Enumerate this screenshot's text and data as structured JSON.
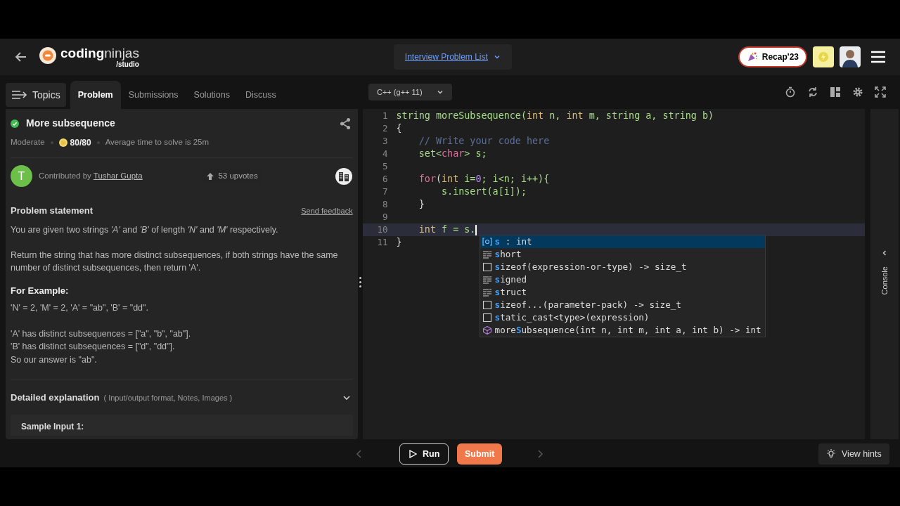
{
  "header": {
    "logo_bold": "coding",
    "logo_light": "ninjas",
    "logo_sub": "/studio",
    "nav_link": "Interview Problem List",
    "recap_label": "Recap'23"
  },
  "left_tabs": {
    "topics": "Topics",
    "tabs": [
      {
        "label": "Problem",
        "selected": true
      },
      {
        "label": "Submissions",
        "selected": false
      },
      {
        "label": "Solutions",
        "selected": false
      },
      {
        "label": "Discuss",
        "selected": false
      }
    ]
  },
  "problem": {
    "title": "More subsequence",
    "solved": true,
    "difficulty": "Moderate",
    "score": "80/80",
    "avg_time": "Average time to solve is 25m",
    "avatar_letter": "T",
    "contributed_prefix": "Contributed by",
    "contributor": "Tushar Gupta",
    "upvotes": "53 upvotes",
    "statement_heading": "Problem statement",
    "feedback": "Send feedback",
    "paragraphs": [
      "You are given two strings *'A'* and *'B'* of length *'N'* and *'M'* respectively.",
      "Return the string that has more distinct subsequences, if both strings have the same number of distinct subsequences, then return 'A'."
    ],
    "example_heading": "For Example:",
    "example_blocks": [
      [
        "'N' = 2, 'M' = 2, 'A' = \"ab\", 'B' = \"dd\"."
      ],
      [
        "'A' has distinct subsequences = [\"a\", \"b\", \"ab\"].",
        "'B' has distinct subsequences = [\"d\", \"dd\"].",
        "So our answer is \"ab\"."
      ]
    ],
    "explanation_heading": "Detailed explanation",
    "explanation_note": "( Input/output format, Notes, Images )",
    "expanded": false,
    "sample_heading": "Sample Input 1:"
  },
  "editor": {
    "language": "C++ (g++ 11)",
    "lines": [
      {
        "number": "1",
        "active": false,
        "tokens": [
          {
            "kind": "plain",
            "text": "string moreSubsequence("
          },
          {
            "kind": "type",
            "text": "int"
          },
          {
            "kind": "plain",
            "text": " n, "
          },
          {
            "kind": "type",
            "text": "int"
          },
          {
            "kind": "plain",
            "text": " m, string a, string b)"
          }
        ]
      },
      {
        "number": "2",
        "active": false,
        "tokens": [
          {
            "kind": "punct",
            "text": "{"
          }
        ]
      },
      {
        "number": "3",
        "active": false,
        "tokens": [
          {
            "kind": "comment",
            "text": "    // Write your code here"
          }
        ]
      },
      {
        "number": "4",
        "active": false,
        "tokens": [
          {
            "kind": "plain",
            "text": "    set<"
          },
          {
            "kind": "keyword",
            "text": "char"
          },
          {
            "kind": "plain",
            "text": "> s;"
          }
        ]
      },
      {
        "number": "5",
        "active": false
      },
      {
        "number": "6",
        "active": false,
        "tokens": [
          {
            "kind": "keyword",
            "text": "    for"
          },
          {
            "kind": "punct",
            "text": "("
          },
          {
            "kind": "type",
            "text": "int"
          },
          {
            "kind": "plain",
            "text": " i="
          },
          {
            "kind": "number",
            "text": "0"
          },
          {
            "kind": "plain",
            "text": "; i<n; i++){"
          }
        ]
      },
      {
        "number": "7",
        "active": false,
        "tokens": [
          {
            "kind": "plain",
            "text": "        s.insert(a[i]);"
          }
        ]
      },
      {
        "number": "8",
        "active": false,
        "tokens": [
          {
            "kind": "punct",
            "text": "    }"
          }
        ]
      },
      {
        "number": "9",
        "active": false
      },
      {
        "number": "10",
        "active": true,
        "tokens": [
          {
            "kind": "type",
            "text": "    int"
          },
          {
            "kind": "plain",
            "text": " f = s."
          }
        ]
      },
      {
        "number": "11",
        "active": false,
        "tokens": [
          {
            "kind": "punct",
            "text": "}"
          }
        ]
      }
    ],
    "suggestions": [
      {
        "kind": "variable",
        "match": "s",
        "rest": " : int",
        "selected": true
      },
      {
        "kind": "keyword",
        "match": "s",
        "rest": "hort",
        "selected": false
      },
      {
        "kind": "snippet",
        "match": "s",
        "rest": "izeof(expression-or-type) -> size_t",
        "selected": false
      },
      {
        "kind": "keyword",
        "match": "s",
        "rest": "igned",
        "selected": false
      },
      {
        "kind": "keyword",
        "match": "s",
        "rest": "truct",
        "selected": false
      },
      {
        "kind": "snippet",
        "match": "s",
        "rest": "izeof...(parameter-pack) -> size_t",
        "selected": false
      },
      {
        "kind": "snippet",
        "match": "s",
        "rest": "tatic_cast<type>(expression)",
        "selected": false
      },
      {
        "kind": "method",
        "prefix": "more",
        "match": "S",
        "rest": "ubsequence(int n, int m, int a, int b) -> int",
        "selected": false
      }
    ]
  },
  "console_label": "Console",
  "footer": {
    "run": "Run",
    "submit": "Submit",
    "hints": "View hints"
  }
}
